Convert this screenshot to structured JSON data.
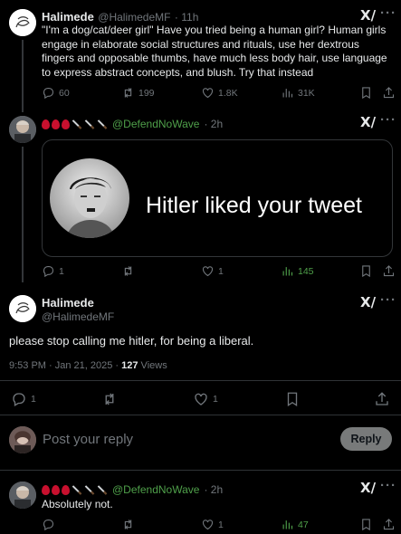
{
  "tweet1": {
    "name": "Halimede",
    "handle": "@HalimedeMF",
    "time": "· 11h",
    "text": "\"I'm a dog/cat/deer girl\" Have you tried being a human girl? Human girls engage in elaborate social structures and rituals, use her dextrous fingers and opposable thumbs, have much less body hair, use language to express abstract concepts, and blush. Try that instead",
    "replies": "60",
    "reposts": "199",
    "likes": "1.8K",
    "views": "31K"
  },
  "tweet2": {
    "handle": "@DefendNoWave",
    "time": "· 2h",
    "image_text": "Hitler liked your tweet",
    "replies": "1",
    "reposts": "",
    "likes": "1",
    "views": "145"
  },
  "main": {
    "name": "Halimede",
    "handle": "@HalimedeMF",
    "text": "please stop calling me hitler, for being a liberal.",
    "timestamp": "9:53 PM · Jan 21, 2025 · ",
    "views_count": "127",
    "views_label": " Views",
    "replies": "1",
    "likes": "1"
  },
  "compose": {
    "placeholder": "Post your reply",
    "button": "Reply"
  },
  "tweet3": {
    "handle": "@DefendNoWave",
    "time": "· 2h",
    "text": "Absolutely not.",
    "likes": "1",
    "views": "47"
  },
  "colors": {
    "accent_green": "#4fa04a",
    "muted": "#71767b",
    "blood_red": "#c8102e"
  },
  "icons": [
    "grok-icon",
    "more-icon",
    "reply-icon",
    "repost-icon",
    "like-icon",
    "views-icon",
    "bookmark-icon",
    "share-icon",
    "drop-of-blood-emoji",
    "knife-emoji"
  ]
}
